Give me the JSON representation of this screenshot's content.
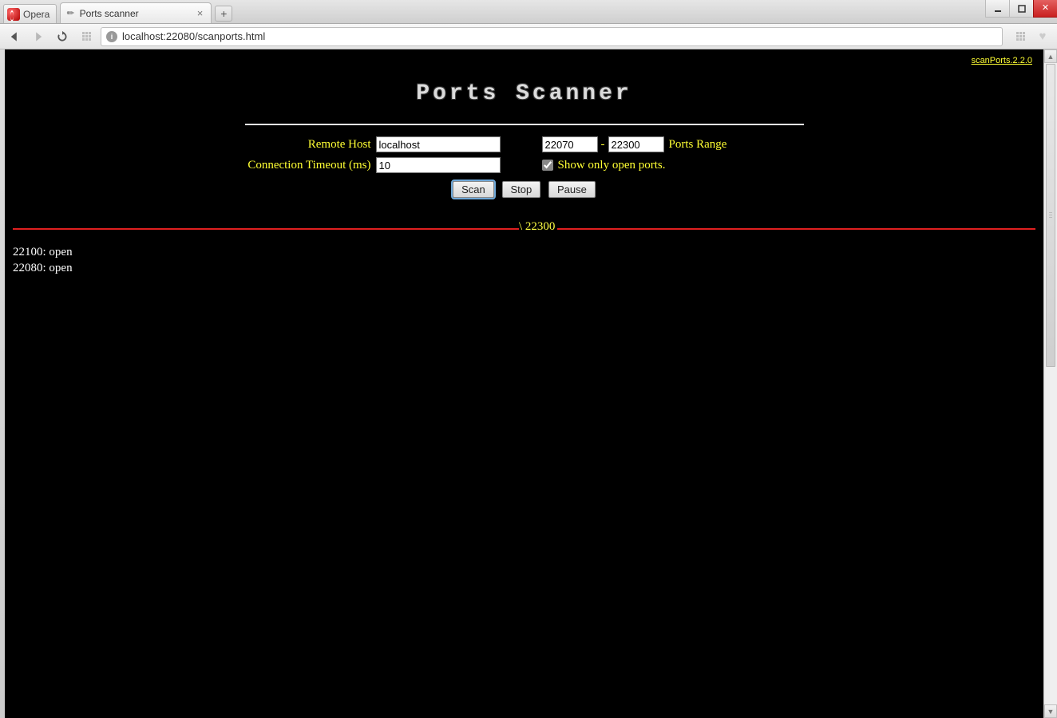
{
  "browser": {
    "opera_label": "Opera",
    "tab_title": "Ports scanner",
    "url": "localhost:22080/scanports.html"
  },
  "page": {
    "version_link": "scanPorts.2.2.0",
    "title": "Ports Scanner",
    "form": {
      "remote_host_label": "Remote Host",
      "remote_host_value": "localhost",
      "port_from_value": "22070",
      "port_to_value": "22300",
      "ports_range_label": "Ports Range",
      "timeout_label": "Connection Timeout (ms)",
      "timeout_value": "10",
      "show_open_label": "Show only open ports.",
      "show_open_checked": true,
      "buttons": {
        "scan": "Scan",
        "stop": "Stop",
        "pause": "Pause"
      }
    },
    "progress": {
      "spinner": "\\",
      "current": "22300"
    },
    "results": [
      "22100: open",
      "22080: open"
    ]
  }
}
